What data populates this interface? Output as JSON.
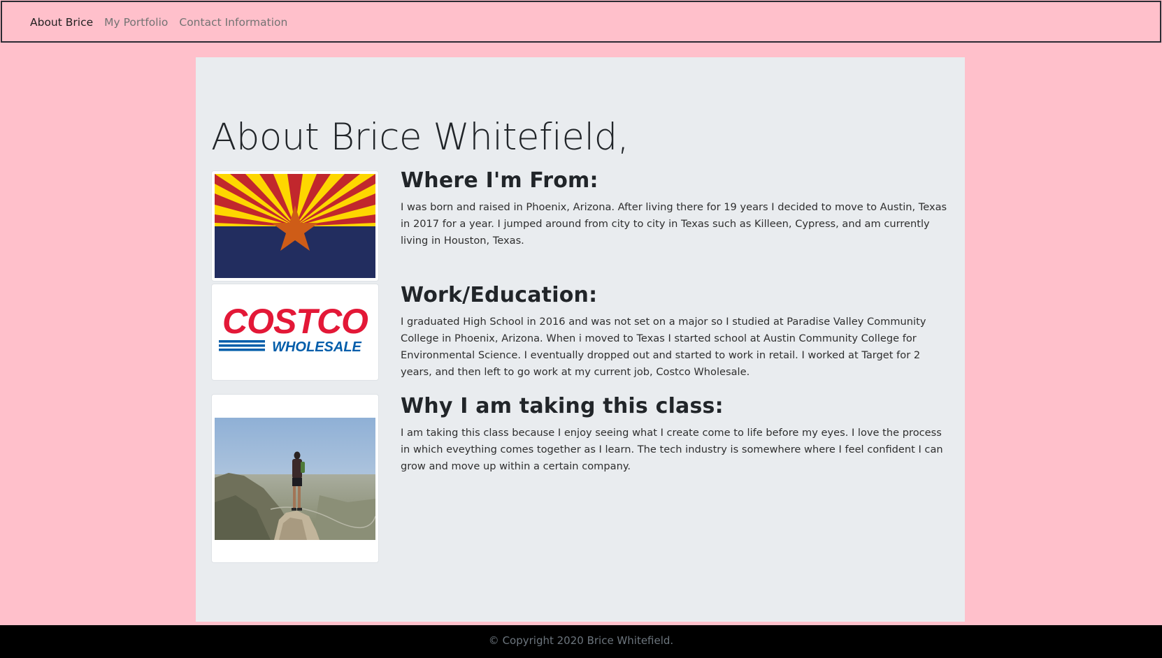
{
  "nav": {
    "items": [
      {
        "label": "About Brice",
        "active": true
      },
      {
        "label": "My Portfolio",
        "active": false
      },
      {
        "label": "Contact Information",
        "active": false
      }
    ]
  },
  "main": {
    "title": "About Brice Whitefield,",
    "sections": [
      {
        "heading": "Where I'm From:",
        "text": "I was born and raised in Phoenix, Arizona. After living there for 19 years I decided to move to Austin, Texas in 2017 for a year. I jumped around from city to city in Texas such as Killeen, Cypress, and am currently living in Houston, Texas.",
        "image": "arizona-flag"
      },
      {
        "heading": "Work/Education:",
        "text": "I graduated High School in 2016 and was not set on a major so I studied at Paradise Valley Community College in Phoenix, Arizona. When i moved to Texas I started school at Austin Community College for Environmental Science. I eventually dropped out and started to work in retail. I worked at Target for 2 years, and then left to go work at my current job, Costco Wholesale.",
        "image": "costco-wholesale-logo"
      },
      {
        "heading": "Why I am taking this class:",
        "text": "I am taking this class because I enjoy seeing what I create come to life before my eyes. I love the process in which eveything comes together as I learn. The tech industry is somewhere where I feel confident I can grow and move up within a certain company.",
        "image": "hiker-on-mountain-photo"
      }
    ],
    "logo_text": {
      "top": "COSTCO",
      "bottom": "WHOLESALE"
    }
  },
  "footer": {
    "text": "© Copyright 2020 Brice Whitefield."
  },
  "colors": {
    "page_bg": "#ffc0cb",
    "jumbotron_bg": "#e9ecef",
    "footer_bg": "#000000",
    "flag_red": "#c1272d",
    "flag_yellow": "#fed700",
    "flag_blue": "#222d5f",
    "flag_star": "#ce5c17",
    "costco_red": "#e31837",
    "costco_blue": "#005daa"
  }
}
